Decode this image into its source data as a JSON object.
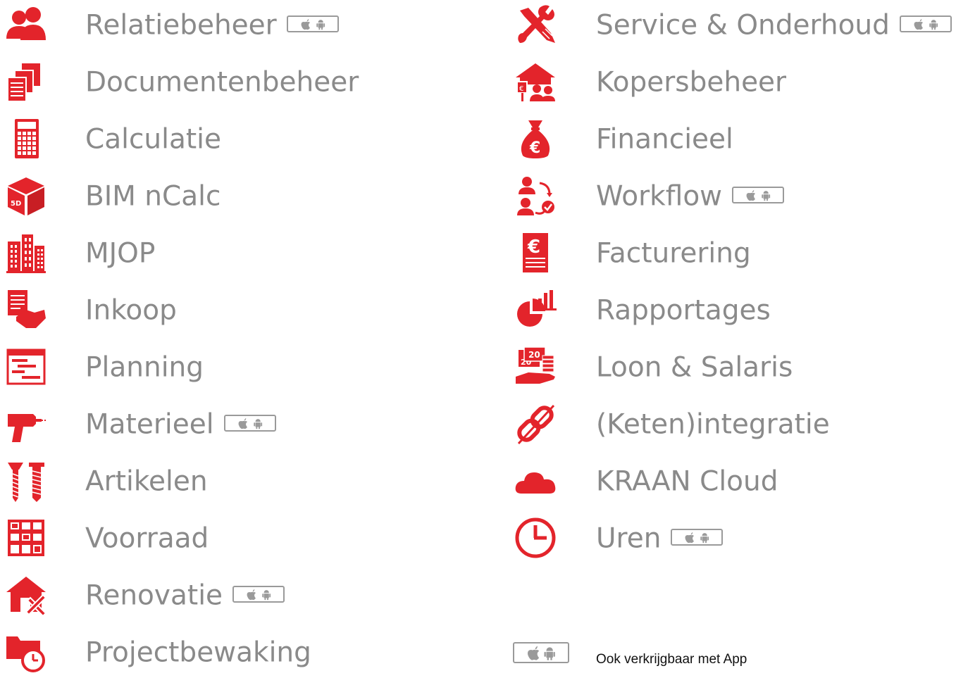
{
  "colors": {
    "accent": "#e3242b",
    "label": "#8a8a8a"
  },
  "left_column": [
    {
      "label": "Relatiebeheer",
      "icon": "relations-icon",
      "app": true
    },
    {
      "label": "Documentenbeheer",
      "icon": "documents-icon",
      "app": false
    },
    {
      "label": "Calculatie",
      "icon": "calculator-icon",
      "app": false
    },
    {
      "label": "BIM nCalc",
      "icon": "bim-cube-icon",
      "app": false
    },
    {
      "label": "MJOP",
      "icon": "buildings-icon",
      "app": false
    },
    {
      "label": "Inkoop",
      "icon": "handshake-icon",
      "app": false
    },
    {
      "label": "Planning",
      "icon": "gantt-icon",
      "app": false
    },
    {
      "label": "Materieel",
      "icon": "drill-icon",
      "app": true
    },
    {
      "label": "Artikelen",
      "icon": "screws-icon",
      "app": false
    },
    {
      "label": "Voorraad",
      "icon": "warehouse-shelves-icon",
      "app": false
    },
    {
      "label": "Renovatie",
      "icon": "house-tools-icon",
      "app": true
    },
    {
      "label": "Projectbewaking",
      "icon": "folder-stopwatch-icon",
      "app": false
    }
  ],
  "right_column": [
    {
      "label": "Service & Onderhoud",
      "icon": "wrench-screwdriver-icon",
      "app": true
    },
    {
      "label": "Kopersbeheer",
      "icon": "house-buyers-icon",
      "app": false
    },
    {
      "label": "Financieel",
      "icon": "money-bag-icon",
      "app": false
    },
    {
      "label": "Workflow",
      "icon": "workflow-people-icon",
      "app": true
    },
    {
      "label": "Facturering",
      "icon": "invoice-icon",
      "app": false
    },
    {
      "label": "Rapportages",
      "icon": "pie-bar-chart-icon",
      "app": false
    },
    {
      "label": "Loon & Salaris",
      "icon": "salary-hand-icon",
      "app": false
    },
    {
      "label": "(Keten)integratie",
      "icon": "chain-link-icon",
      "app": false
    },
    {
      "label": "KRAAN Cloud",
      "icon": "cloud-icon",
      "app": false
    },
    {
      "label": "Uren",
      "icon": "clock-icon",
      "app": true
    }
  ],
  "legend": {
    "text": "Ook verkrijgbaar met App",
    "icon": "apple-android-badge-icon"
  }
}
